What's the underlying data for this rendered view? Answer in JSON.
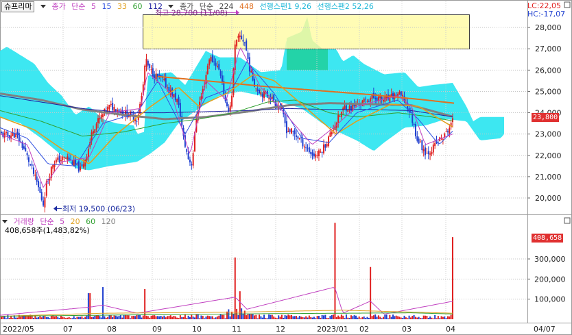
{
  "price_legend": {
    "title": "슈프리마",
    "close_label": "종가",
    "ma_label": "단순",
    "periods": [
      "5",
      "15",
      "33",
      "60",
      "112"
    ],
    "close_label2": "종가",
    "ma_label2": "단순",
    "long_periods": [
      "224",
      "448"
    ],
    "span1": "선행스팬1 9,26",
    "span2": "선행스팬2 52,26",
    "lc": "LC:22,05",
    "hc": "HC:-17,07"
  },
  "volume_legend": {
    "title": "거래량",
    "ma_label": "단순",
    "periods": [
      "5",
      "20",
      "60",
      "120"
    ],
    "summary": "408,658주(1,483,82%)"
  },
  "colors": {
    "up": "#e02020",
    "down": "#2040d0",
    "cloud": "#33e6f0",
    "cloud_green": "#20d0a0",
    "ma5": "#c040c0",
    "ma15": "#3050e0",
    "ma33": "#e0a020",
    "ma60": "#30a030",
    "ma112": "#2020a0",
    "ma224": "#808080",
    "ma448": "#e07020",
    "highlight_box": "#fffca8"
  },
  "chart_data": [
    {
      "type": "line",
      "name": "price",
      "y_axis": {
        "min": 19300,
        "max": 29100,
        "ticks": [
          "28,000",
          "27,000",
          "26,000",
          "25,000",
          "24,000",
          "23,000",
          "22,000",
          "21,000",
          "20,000"
        ],
        "tick_values": [
          28000,
          27000,
          26000,
          25000,
          24000,
          23000,
          22000,
          21000,
          20000
        ]
      },
      "current_price": "23,800",
      "current_value": 23800,
      "annotations": {
        "high": "최고 28,700 (11/08)",
        "low": "최저 19,500 (06/23)"
      },
      "x_labels": [
        "2022/05",
        "07",
        "08",
        "09",
        "10",
        "11",
        "12",
        "2023/01",
        "02",
        "03",
        "04",
        "04/07"
      ],
      "close_anchors": [
        [
          0,
          23000
        ],
        [
          12,
          22900
        ],
        [
          20,
          23000
        ],
        [
          25,
          22900
        ],
        [
          35,
          22300
        ],
        [
          45,
          21500
        ],
        [
          55,
          20600
        ],
        [
          63,
          19700
        ],
        [
          68,
          20700
        ],
        [
          78,
          21700
        ],
        [
          88,
          21800
        ],
        [
          98,
          21900
        ],
        [
          108,
          21600
        ],
        [
          118,
          21300
        ],
        [
          128,
          22200
        ],
        [
          136,
          23300
        ],
        [
          145,
          23700
        ],
        [
          152,
          24000
        ],
        [
          160,
          24300
        ],
        [
          170,
          24200
        ],
        [
          180,
          24000
        ],
        [
          190,
          23900
        ],
        [
          200,
          23700
        ],
        [
          208,
          25000
        ],
        [
          212,
          26500
        ],
        [
          218,
          26000
        ],
        [
          228,
          25700
        ],
        [
          238,
          25500
        ],
        [
          250,
          24900
        ],
        [
          258,
          24600
        ],
        [
          263,
          23900
        ],
        [
          268,
          22700
        ],
        [
          275,
          21800
        ],
        [
          280,
          21600
        ],
        [
          287,
          24000
        ],
        [
          297,
          25200
        ],
        [
          305,
          26600
        ],
        [
          315,
          26300
        ],
        [
          323,
          25700
        ],
        [
          330,
          24100
        ],
        [
          337,
          24400
        ],
        [
          343,
          27200
        ],
        [
          350,
          27600
        ],
        [
          357,
          27300
        ],
        [
          365,
          25900
        ],
        [
          373,
          25200
        ],
        [
          383,
          24900
        ],
        [
          393,
          24800
        ],
        [
          403,
          24400
        ],
        [
          410,
          24200
        ],
        [
          418,
          23200
        ],
        [
          426,
          23100
        ],
        [
          436,
          22800
        ],
        [
          446,
          22400
        ],
        [
          456,
          22000
        ],
        [
          466,
          22100
        ],
        [
          476,
          22600
        ],
        [
          486,
          23300
        ],
        [
          496,
          23900
        ],
        [
          503,
          24300
        ],
        [
          511,
          24200
        ],
        [
          520,
          24400
        ],
        [
          530,
          24500
        ],
        [
          540,
          24700
        ],
        [
          550,
          24700
        ],
        [
          560,
          24600
        ],
        [
          570,
          24700
        ],
        [
          580,
          24900
        ],
        [
          590,
          24600
        ],
        [
          600,
          23800
        ],
        [
          608,
          22800
        ],
        [
          615,
          22400
        ],
        [
          622,
          22100
        ],
        [
          630,
          22300
        ],
        [
          640,
          22700
        ],
        [
          648,
          22900
        ],
        [
          655,
          23300
        ],
        [
          660,
          23600
        ],
        [
          662,
          23800
        ]
      ],
      "ma_anchors": {
        "ma5": [
          [
            0,
            23000
          ],
          [
            40,
            22500
          ],
          [
            63,
            20500
          ],
          [
            90,
            21700
          ],
          [
            130,
            21900
          ],
          [
            160,
            24000
          ],
          [
            205,
            24200
          ],
          [
            215,
            25900
          ],
          [
            250,
            24900
          ],
          [
            277,
            22000
          ],
          [
            300,
            25500
          ],
          [
            330,
            24600
          ],
          [
            350,
            27100
          ],
          [
            380,
            25200
          ],
          [
            420,
            23800
          ],
          [
            455,
            22500
          ],
          [
            490,
            23400
          ],
          [
            520,
            24300
          ],
          [
            580,
            24800
          ],
          [
            600,
            24300
          ],
          [
            620,
            22500
          ],
          [
            660,
            23000
          ]
        ],
        "ma15": [
          [
            0,
            23300
          ],
          [
            40,
            22800
          ],
          [
            70,
            21600
          ],
          [
            110,
            21500
          ],
          [
            150,
            23500
          ],
          [
            200,
            24000
          ],
          [
            230,
            25500
          ],
          [
            270,
            23000
          ],
          [
            300,
            24700
          ],
          [
            340,
            25200
          ],
          [
            360,
            26400
          ],
          [
            400,
            24900
          ],
          [
            440,
            22800
          ],
          [
            480,
            22600
          ],
          [
            520,
            24000
          ],
          [
            580,
            24600
          ],
          [
            610,
            23700
          ],
          [
            640,
            22500
          ],
          [
            662,
            23200
          ]
        ],
        "ma33": [
          [
            0,
            23800
          ],
          [
            50,
            23200
          ],
          [
            90,
            22300
          ],
          [
            130,
            21600
          ],
          [
            170,
            23000
          ],
          [
            220,
            24300
          ],
          [
            260,
            25200
          ],
          [
            290,
            24300
          ],
          [
            330,
            24900
          ],
          [
            370,
            25800
          ],
          [
            400,
            25500
          ],
          [
            440,
            24400
          ],
          [
            490,
            23000
          ],
          [
            520,
            23600
          ],
          [
            570,
            24400
          ],
          [
            610,
            24300
          ],
          [
            662,
            23300
          ]
        ],
        "ma60": [
          [
            0,
            24100
          ],
          [
            60,
            23600
          ],
          [
            120,
            22900
          ],
          [
            180,
            23100
          ],
          [
            240,
            23500
          ],
          [
            290,
            23700
          ],
          [
            340,
            24000
          ],
          [
            390,
            24500
          ],
          [
            430,
            24600
          ],
          [
            480,
            24000
          ],
          [
            520,
            23800
          ],
          [
            580,
            24000
          ],
          [
            630,
            23800
          ],
          [
            662,
            23600
          ]
        ],
        "ma112": [
          [
            0,
            24800
          ],
          [
            60,
            24500
          ],
          [
            120,
            24200
          ],
          [
            180,
            24000
          ],
          [
            240,
            24000
          ],
          [
            300,
            24050
          ],
          [
            360,
            24100
          ],
          [
            420,
            24200
          ],
          [
            480,
            24150
          ],
          [
            540,
            24150
          ],
          [
            600,
            24100
          ],
          [
            662,
            23800
          ]
        ],
        "ma224": [
          [
            0,
            24900
          ],
          [
            60,
            24600
          ],
          [
            120,
            24150
          ],
          [
            180,
            23900
          ],
          [
            240,
            23700
          ],
          [
            300,
            23800
          ],
          [
            360,
            24050
          ],
          [
            420,
            24350
          ],
          [
            480,
            24450
          ],
          [
            540,
            24400
          ],
          [
            600,
            24350
          ],
          [
            662,
            23800
          ]
        ],
        "ma448": [
          [
            230,
            25700
          ],
          [
            300,
            25500
          ],
          [
            380,
            25250
          ],
          [
            460,
            25050
          ],
          [
            540,
            24850
          ],
          [
            620,
            24600
          ],
          [
            662,
            24450
          ]
        ]
      },
      "cloud_top": [
        [
          0,
          26900
        ],
        [
          10,
          27100
        ],
        [
          30,
          26700
        ],
        [
          50,
          26300
        ],
        [
          70,
          25400
        ],
        [
          90,
          24800
        ],
        [
          110,
          23900
        ],
        [
          130,
          24300
        ],
        [
          150,
          23700
        ],
        [
          170,
          23500
        ],
        [
          195,
          23400
        ],
        [
          200,
          23000
        ],
        [
          210,
          23100
        ],
        [
          215,
          25700
        ],
        [
          220,
          25800
        ],
        [
          250,
          25900
        ],
        [
          270,
          25300
        ],
        [
          300,
          26900
        ],
        [
          320,
          26600
        ],
        [
          350,
          26600
        ],
        [
          380,
          25900
        ],
        [
          410,
          26000
        ],
        [
          418,
          27500
        ],
        [
          440,
          27800
        ],
        [
          448,
          28500
        ],
        [
          455,
          27400
        ],
        [
          470,
          27000
        ],
        [
          490,
          27000
        ],
        [
          500,
          26400
        ],
        [
          515,
          26700
        ],
        [
          530,
          26300
        ],
        [
          560,
          25800
        ],
        [
          590,
          25900
        ],
        [
          610,
          25200
        ],
        [
          630,
          25300
        ],
        [
          660,
          25400
        ],
        [
          680,
          24300
        ],
        [
          690,
          23600
        ],
        [
          700,
          23800
        ],
        [
          735,
          23800
        ]
      ],
      "cloud_bottom": [
        [
          0,
          23800
        ],
        [
          30,
          23500
        ],
        [
          60,
          22800
        ],
        [
          90,
          22000
        ],
        [
          110,
          21400
        ],
        [
          130,
          21300
        ],
        [
          160,
          21500
        ],
        [
          200,
          21700
        ],
        [
          220,
          22100
        ],
        [
          240,
          22600
        ],
        [
          260,
          23500
        ],
        [
          290,
          24200
        ],
        [
          320,
          24800
        ],
        [
          350,
          25000
        ],
        [
          380,
          24800
        ],
        [
          400,
          24600
        ],
        [
          420,
          24400
        ],
        [
          440,
          24200
        ],
        [
          470,
          23500
        ],
        [
          500,
          23000
        ],
        [
          520,
          22700
        ],
        [
          545,
          22200
        ],
        [
          560,
          22600
        ],
        [
          590,
          23300
        ],
        [
          620,
          23400
        ],
        [
          650,
          23700
        ],
        [
          680,
          23600
        ],
        [
          700,
          22700
        ],
        [
          730,
          22800
        ],
        [
          735,
          23000
        ]
      ]
    },
    {
      "type": "bar",
      "name": "volume",
      "y_axis": {
        "min": 0,
        "max": 520000,
        "ticks": [
          "300,000",
          "200,000",
          "100,000"
        ],
        "tick_values": [
          300000,
          200000,
          100000
        ]
      },
      "current_volume": "408,658",
      "current_value": 408658,
      "spikes": [
        [
          130,
          130000
        ],
        [
          150,
          160000
        ],
        [
          212,
          150000
        ],
        [
          343,
          290000
        ],
        [
          350,
          130000
        ],
        [
          488,
          480000
        ],
        [
          540,
          260000
        ],
        [
          661,
          408658
        ]
      ]
    }
  ]
}
